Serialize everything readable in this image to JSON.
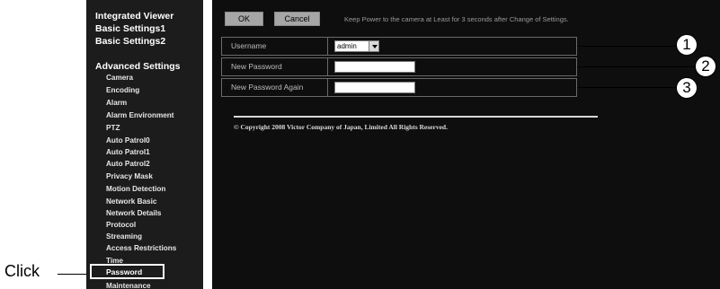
{
  "annotation": {
    "click_label": "Click"
  },
  "sidebar": {
    "top_items": [
      {
        "label": "Integrated Viewer"
      },
      {
        "label": "Basic Settings1"
      },
      {
        "label": "Basic Settings2"
      },
      {
        "label": "Advanced Settings"
      }
    ],
    "items": [
      {
        "label": "Camera"
      },
      {
        "label": "Encoding"
      },
      {
        "label": "Alarm"
      },
      {
        "label": "Alarm Environment"
      },
      {
        "label": "PTZ"
      },
      {
        "label": "Auto Patrol0"
      },
      {
        "label": "Auto Patrol1"
      },
      {
        "label": "Auto Patrol2"
      },
      {
        "label": "Privacy Mask"
      },
      {
        "label": "Motion Detection"
      },
      {
        "label": "Network Basic"
      },
      {
        "label": "Network Details"
      },
      {
        "label": "Protocol"
      },
      {
        "label": "Streaming"
      },
      {
        "label": "Access Restrictions"
      },
      {
        "label": "Time"
      },
      {
        "label": "Maintenance"
      }
    ],
    "active_item": "Password"
  },
  "toolbar": {
    "ok_label": "OK",
    "cancel_label": "Cancel",
    "notice": "Keep Power to the camera at Least for 3 seconds after Change of Settings."
  },
  "form": {
    "username_label": "Username",
    "username_value": "admin",
    "new_password_label": "New Password",
    "new_password_again_label": "New Password Again"
  },
  "footer": {
    "copyright": "© Copyright 2008 Victor Company of Japan, Limited All Rights Reserved."
  },
  "callouts": [
    "1",
    "2",
    "3"
  ],
  "colors": {
    "sidebar_bg": "#1c1c1c",
    "main_bg": "#0e0e0e",
    "button_bg": "#a6a6a6"
  }
}
